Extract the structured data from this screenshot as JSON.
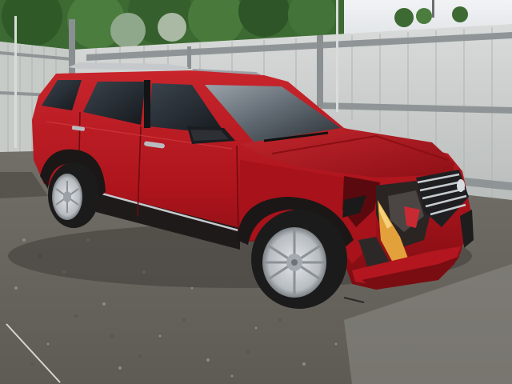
{
  "scene": {
    "subject": "red-suv-front-collision-damage",
    "colors": {
      "sky": "#e9ecef",
      "foliage": "#3f6b34",
      "fence": "#c9ccc9",
      "fence_post": "#8f9597",
      "gravel": "#7b7872",
      "concrete": "#9c9a94",
      "paint": "#b0151e",
      "paint_dark": "#6d0b10",
      "glass": "#1d2126",
      "chrome": "#c7ccd0",
      "tire": "#1b1b1b",
      "turn_signal": "#e2a13a"
    }
  }
}
